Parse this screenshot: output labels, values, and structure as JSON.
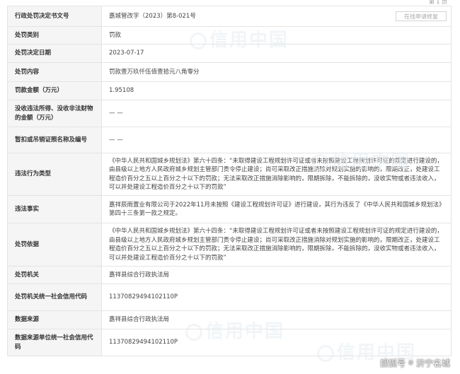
{
  "pager": {
    "text": "第 1 页"
  },
  "actions": {
    "correction_label": "在线申请修复"
  },
  "watermarks": [
    "信用中国",
    "信用中国",
    "信用中国",
    "信用中国"
  ],
  "rows": [
    {
      "label": "行政处罚决定书文号",
      "value": "嘉城管改字（2023）第8-021号"
    },
    {
      "label": "处罚类别",
      "value": "罚款"
    },
    {
      "label": "处罚决定日期",
      "value": "2023-07-17"
    },
    {
      "label": "处罚内容",
      "value": "罚款壹万玖仟伍佰壹拾元八角零分"
    },
    {
      "label": "罚款金额（万元）",
      "value": "1.95108"
    },
    {
      "label": "没收违法所得、没收非法财物的金额（万元）",
      "value": "— —"
    },
    {
      "label": "暂扣或吊销证照名称及编号",
      "value": "— —"
    },
    {
      "label": "违法行为类型",
      "value": "《中华人民共和国城乡规划法》第六十四条：“未取得建设工程规划许可证或者未按照建设工程规划许可证的规定进行建设的，由县级以上地方人民政府城乡规划主管部门责令停止建设；尚可采取改正措施消除对规划实施的影响的，限期改正，处建设工程造价百分之五以上百分之十以下的罚款；无法采取改正措施消除影响的，限期拆除，不能拆除的，没收实物或者违法收入，可以并处建设工程造价百分之十以下的罚款”"
    },
    {
      "label": "违法事实",
      "value": "嘉祥辰雨置业有限公司于2022年11月未按照《建设工程规划许可证》进行建设，其行为违反了《中华人民共和国城乡规划法》第四十三条第一款之规定。"
    },
    {
      "label": "处罚依据",
      "value": "《中华人民共和国城乡规划法》第六十四条：“未取得建设工程规划许可证或者未按照建设工程规划许可证的规定进行建设的，由县级以上地方人民政府城乡规划主管部门责令停止建设；尚可采取改正措施消除对规划实施的影响的，限期改正，处建设工程造价百分之五以上百分之十以下的罚款；无法采取改正措施消除影响的，限期拆除，不能拆除的，没收实物或者违法收入，可以并处建设工程造价百分之十以下的罚款”"
    },
    {
      "label": "处罚机关",
      "value": "嘉祥县综合行政执法局"
    },
    {
      "label": "处罚机关统一社会信用代码",
      "value": "11370829494102110P"
    },
    {
      "label": "数据来源",
      "value": "嘉祥县综合行政执法局"
    },
    {
      "label": "数据来源单位统一社会信用代码",
      "value": "11370829494102110P"
    }
  ],
  "credit": {
    "prefix": "搜狐号",
    "at": "@",
    "account": "济宁名城"
  }
}
